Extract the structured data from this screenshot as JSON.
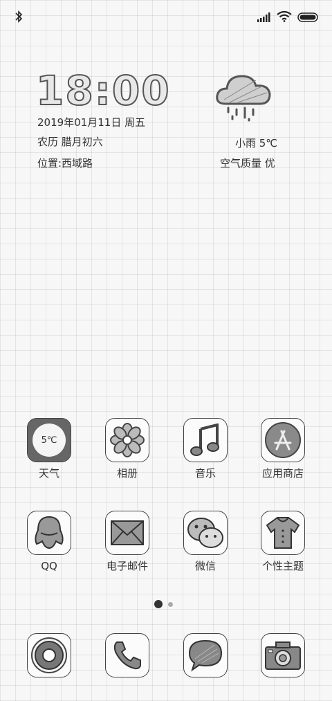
{
  "status_bar": {
    "icons": [
      "bluetooth-icon",
      "signal-icon",
      "wifi-icon",
      "battery-icon"
    ]
  },
  "clock": {
    "time": "18:00",
    "date": "2019年01月11日 周五",
    "lunar": "农历 腊月初六",
    "location": "位置:西域路"
  },
  "weather": {
    "icon": "rain-cloud-icon",
    "condition": "小雨 5℃",
    "air_quality": "空气质量 优"
  },
  "apps_row1": [
    {
      "label": "天气",
      "icon": "weather-app-icon",
      "badge": "5℃"
    },
    {
      "label": "相册",
      "icon": "gallery-flower-icon"
    },
    {
      "label": "音乐",
      "icon": "music-note-icon"
    },
    {
      "label": "应用商店",
      "icon": "app-store-icon"
    }
  ],
  "apps_row2": [
    {
      "label": "QQ",
      "icon": "qq-penguin-icon"
    },
    {
      "label": "电子邮件",
      "icon": "mail-envelope-icon"
    },
    {
      "label": "微信",
      "icon": "wechat-icon"
    },
    {
      "label": "个性主题",
      "icon": "theme-shirt-icon"
    }
  ],
  "page_indicator": {
    "pages": 2,
    "current": 1
  },
  "dock": [
    {
      "icon": "browser-icon"
    },
    {
      "icon": "phone-icon"
    },
    {
      "icon": "messages-icon"
    },
    {
      "icon": "camera-icon"
    }
  ]
}
